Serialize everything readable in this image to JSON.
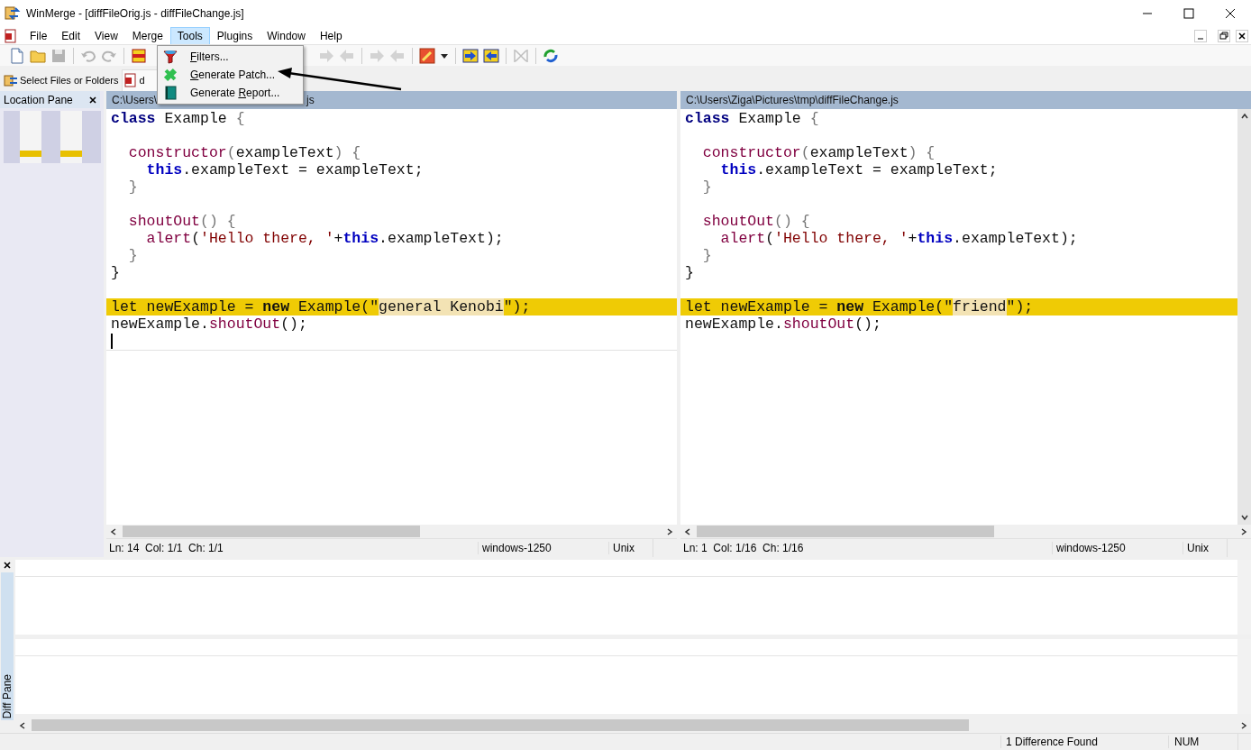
{
  "window": {
    "title": "WinMerge - [diffFileOrig.js - diffFileChange.js]"
  },
  "menu": [
    {
      "label": "File",
      "selected": false
    },
    {
      "label": "Edit",
      "selected": false
    },
    {
      "label": "View",
      "selected": false
    },
    {
      "label": "Merge",
      "selected": false
    },
    {
      "label": "Tools",
      "selected": true
    },
    {
      "label": "Plugins",
      "selected": false
    },
    {
      "label": "Window",
      "selected": false
    },
    {
      "label": "Help",
      "selected": false
    }
  ],
  "tools_menu": [
    {
      "kind": "funnel",
      "key": "F",
      "after": "ilters..."
    },
    {
      "kind": "patch",
      "key": "G",
      "after": "enerate Patch..."
    },
    {
      "kind": "report",
      "before": "Generate ",
      "key": "R",
      "after": "eport..."
    }
  ],
  "toolbar": [
    {
      "kind": "new",
      "disabled": false
    },
    {
      "kind": "open",
      "disabled": false
    },
    {
      "kind": "save",
      "disabled": true
    },
    {
      "kind": "separator"
    },
    {
      "kind": "undo",
      "disabled": true
    },
    {
      "kind": "redo",
      "disabled": true
    },
    {
      "kind": "separator"
    },
    {
      "kind": "merge",
      "disabled": false
    },
    {
      "kind": "gap"
    },
    {
      "kind": "next",
      "disabled": true
    },
    {
      "kind": "prev",
      "disabled": true
    },
    {
      "kind": "separator"
    },
    {
      "kind": "next",
      "disabled": true
    },
    {
      "kind": "prev",
      "disabled": true
    },
    {
      "kind": "separator"
    },
    {
      "kind": "tools",
      "disabled": false
    },
    {
      "kind": "caret",
      "disabled": false
    },
    {
      "kind": "separator"
    },
    {
      "kind": "copy-right",
      "disabled": false
    },
    {
      "kind": "copy-left",
      "disabled": false
    },
    {
      "kind": "separator"
    },
    {
      "kind": "collapse",
      "disabled": true
    },
    {
      "kind": "separator"
    },
    {
      "kind": "refresh",
      "disabled": false
    }
  ],
  "tabs": [
    {
      "kind": "folder",
      "label": "Select Files or Folders",
      "selected": false
    },
    {
      "kind": "doc",
      "label": "d",
      "selected": true
    }
  ],
  "location_pane": {
    "title": "Location Pane"
  },
  "panes": [
    {
      "path_parts": [
        "C:\\Users\\",
        "js"
      ],
      "lines": [
        {
          "diff": false,
          "cursor": false,
          "tokens": [
            {
              "kind": "class",
              "text": "class"
            },
            {
              "kind": "plain",
              "text": " Example "
            },
            {
              "kind": "punct",
              "text": "{"
            }
          ]
        },
        {
          "diff": false,
          "cursor": false
        },
        {
          "diff": false,
          "cursor": false,
          "tokens": [
            {
              "kind": "name",
              "text": "  constructor"
            },
            {
              "kind": "punct",
              "text": "("
            },
            {
              "kind": "plain",
              "text": "exampleText"
            },
            {
              "kind": "punct",
              "text": ") {"
            }
          ]
        },
        {
          "diff": false,
          "cursor": false,
          "tokens": [
            {
              "kind": "this",
              "text": "    this"
            },
            {
              "kind": "plain",
              "text": ".exampleText = exampleText;"
            }
          ]
        },
        {
          "diff": false,
          "cursor": false,
          "tokens": [
            {
              "kind": "punct",
              "text": "  }"
            }
          ]
        },
        {
          "diff": false,
          "cursor": false
        },
        {
          "diff": false,
          "cursor": false,
          "tokens": [
            {
              "kind": "name",
              "text": "  shoutOut"
            },
            {
              "kind": "punct",
              "text": "() {"
            }
          ]
        },
        {
          "diff": false,
          "cursor": false,
          "tokens": [
            {
              "kind": "name",
              "text": "    alert"
            },
            {
              "kind": "plain",
              "text": "("
            },
            {
              "kind": "str",
              "text": "'Hello there, '"
            },
            {
              "kind": "plain",
              "text": "+"
            },
            {
              "kind": "this",
              "text": "this"
            },
            {
              "kind": "plain",
              "text": ".exampleText);"
            }
          ]
        },
        {
          "diff": false,
          "cursor": false,
          "tokens": [
            {
              "kind": "punct",
              "text": "  }"
            }
          ]
        },
        {
          "diff": false,
          "cursor": false,
          "tokens": [
            {
              "kind": "plain",
              "text": "}"
            }
          ]
        },
        {
          "diff": false,
          "cursor": false
        },
        {
          "diff": true,
          "cursor": false,
          "tokens": [
            {
              "kind": "plain",
              "text": "let newExample = ",
              "changed": false
            },
            {
              "kind": "new",
              "text": "new",
              "changed": false
            },
            {
              "kind": "plain",
              "text": " Example(\"",
              "changed": false
            },
            {
              "kind": "plain",
              "text": "general Kenobi",
              "changed": true
            },
            {
              "kind": "plain",
              "text": "\");",
              "changed": false
            }
          ]
        },
        {
          "diff": false,
          "cursor": false,
          "tokens": [
            {
              "kind": "plain",
              "text": "newExample."
            },
            {
              "kind": "name",
              "text": "shoutOut"
            },
            {
              "kind": "plain",
              "text": "();"
            }
          ]
        },
        {
          "diff": false,
          "cursor": true
        }
      ],
      "status": {
        "position": "Ln: 14  Col: 1/1  Ch: 1/1",
        "encoding": "windows-1250",
        "eol": "Unix"
      }
    },
    {
      "path_parts": [
        "C:\\Users\\Ziga\\Pictures\\tmp\\diffFileChange.js"
      ],
      "lines": [
        {
          "diff": false,
          "cursor": false,
          "tokens": [
            {
              "kind": "class",
              "text": "class"
            },
            {
              "kind": "plain",
              "text": " Example "
            },
            {
              "kind": "punct",
              "text": "{"
            }
          ]
        },
        {
          "diff": false,
          "cursor": false
        },
        {
          "diff": false,
          "cursor": false,
          "tokens": [
            {
              "kind": "name",
              "text": "  constructor"
            },
            {
              "kind": "punct",
              "text": "("
            },
            {
              "kind": "plain",
              "text": "exampleText"
            },
            {
              "kind": "punct",
              "text": ") {"
            }
          ]
        },
        {
          "diff": false,
          "cursor": false,
          "tokens": [
            {
              "kind": "this",
              "text": "    this"
            },
            {
              "kind": "plain",
              "text": ".exampleText = exampleText;"
            }
          ]
        },
        {
          "diff": false,
          "cursor": false,
          "tokens": [
            {
              "kind": "punct",
              "text": "  }"
            }
          ]
        },
        {
          "diff": false,
          "cursor": false
        },
        {
          "diff": false,
          "cursor": false,
          "tokens": [
            {
              "kind": "name",
              "text": "  shoutOut"
            },
            {
              "kind": "punct",
              "text": "() {"
            }
          ]
        },
        {
          "diff": false,
          "cursor": false,
          "tokens": [
            {
              "kind": "name",
              "text": "    alert"
            },
            {
              "kind": "plain",
              "text": "("
            },
            {
              "kind": "str",
              "text": "'Hello there, '"
            },
            {
              "kind": "plain",
              "text": "+"
            },
            {
              "kind": "this",
              "text": "this"
            },
            {
              "kind": "plain",
              "text": ".exampleText);"
            }
          ]
        },
        {
          "diff": false,
          "cursor": false,
          "tokens": [
            {
              "kind": "punct",
              "text": "  }"
            }
          ]
        },
        {
          "diff": false,
          "cursor": false,
          "tokens": [
            {
              "kind": "plain",
              "text": "}"
            }
          ]
        },
        {
          "diff": false,
          "cursor": false
        },
        {
          "diff": true,
          "cursor": false,
          "tokens": [
            {
              "kind": "plain",
              "text": "let newExample = ",
              "changed": false
            },
            {
              "kind": "new",
              "text": "new",
              "changed": false
            },
            {
              "kind": "plain",
              "text": " Example(\"",
              "changed": false
            },
            {
              "kind": "plain",
              "text": "friend",
              "changed": true
            },
            {
              "kind": "plain",
              "text": "\");",
              "changed": false
            }
          ]
        },
        {
          "diff": false,
          "cursor": false,
          "tokens": [
            {
              "kind": "plain",
              "text": "newExample."
            },
            {
              "kind": "name",
              "text": "shoutOut"
            },
            {
              "kind": "plain",
              "text": "();"
            }
          ]
        }
      ],
      "status": {
        "position": "Ln: 1  Col: 1/16  Ch: 1/16",
        "encoding": "windows-1250",
        "eol": "Unix"
      }
    }
  ],
  "diff_pane": {
    "title": "Diff Pane"
  },
  "status_bar": {
    "message": "1 Difference Found",
    "num": "NUM"
  }
}
